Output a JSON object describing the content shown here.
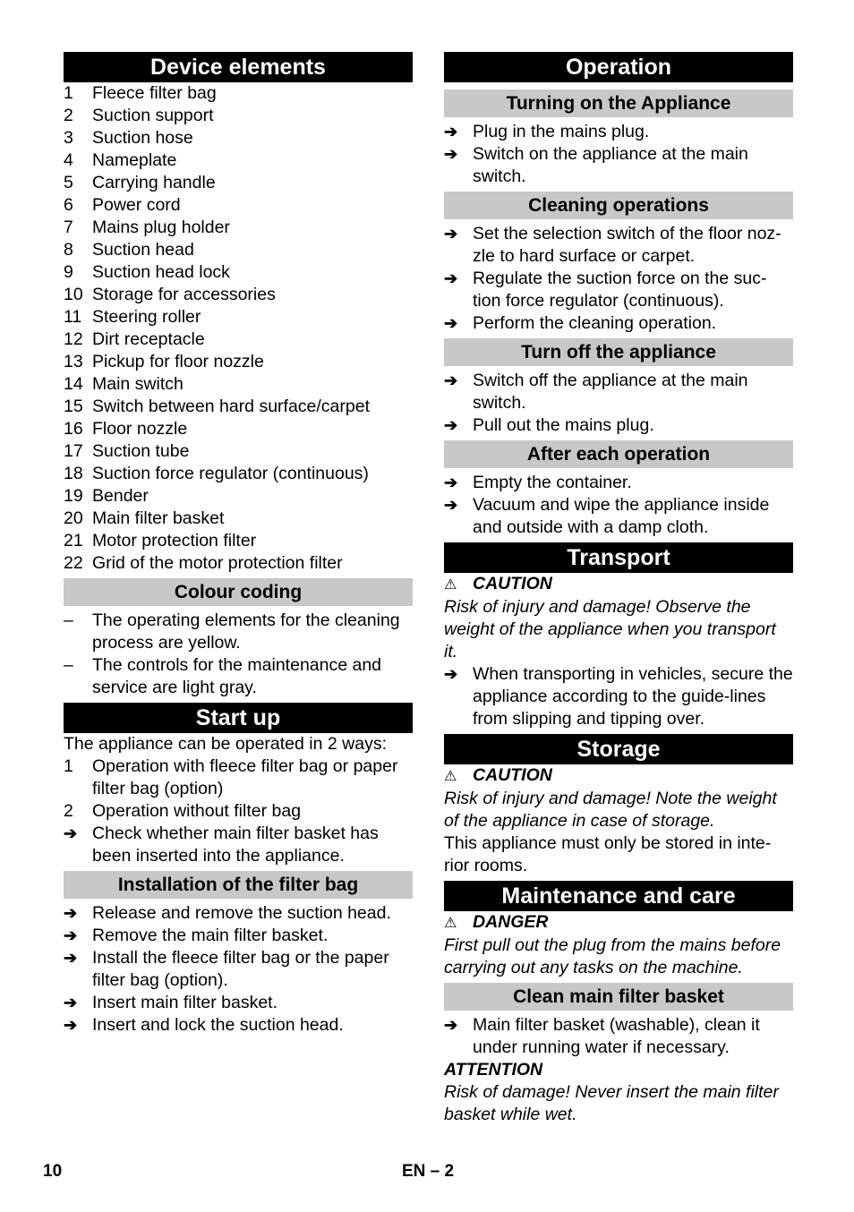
{
  "left": {
    "device_elements": {
      "title": "Device elements",
      "items": [
        {
          "num": "1",
          "text": "Fleece filter bag"
        },
        {
          "num": "2",
          "text": "Suction support"
        },
        {
          "num": "3",
          "text": "Suction hose"
        },
        {
          "num": "4",
          "text": "Nameplate"
        },
        {
          "num": "5",
          "text": "Carrying handle"
        },
        {
          "num": "6",
          "text": "Power cord"
        },
        {
          "num": "7",
          "text": "Mains plug holder"
        },
        {
          "num": "8",
          "text": "Suction head"
        },
        {
          "num": "9",
          "text": "Suction head lock"
        },
        {
          "num": "10",
          "text": "Storage for accessories"
        },
        {
          "num": "11",
          "text": "Steering roller"
        },
        {
          "num": "12",
          "text": "Dirt receptacle"
        },
        {
          "num": "13",
          "text": "Pickup for floor nozzle"
        },
        {
          "num": "14",
          "text": "Main switch"
        },
        {
          "num": "15",
          "text": "Switch between hard surface/carpet"
        },
        {
          "num": "16",
          "text": "Floor nozzle"
        },
        {
          "num": "17",
          "text": "Suction tube"
        },
        {
          "num": "18",
          "text": "Suction force regulator (continuous)"
        },
        {
          "num": "19",
          "text": "Bender"
        },
        {
          "num": "20",
          "text": "Main filter basket"
        },
        {
          "num": "21",
          "text": "Motor protection filter"
        },
        {
          "num": "22",
          "text": "Grid of the motor protection filter"
        }
      ]
    },
    "colour_coding": {
      "title": "Colour coding",
      "bullet": "–",
      "items": [
        "The operating elements for the cleaning process are yellow.",
        "The controls for the maintenance and service are light gray."
      ]
    },
    "start_up": {
      "title": "Start up",
      "intro": "The appliance can be operated in 2 ways:",
      "ways": [
        {
          "num": "1",
          "text": "Operation with fleece filter bag or paper filter bag (option)"
        },
        {
          "num": "2",
          "text": "Operation without filter bag"
        }
      ],
      "check": "Check whether main filter basket has been inserted into the appliance."
    },
    "filter_bag": {
      "title": "Installation of the filter bag",
      "steps": [
        "Release and remove the suction head.",
        "Remove the main filter basket.",
        "Install the fleece filter bag or the paper filter bag (option).",
        "Insert main filter basket.",
        "Insert and lock the suction head."
      ]
    }
  },
  "right": {
    "operation": {
      "title": "Operation",
      "turning_on": {
        "title": "Turning on the Appliance",
        "steps": [
          "Plug in the mains plug.",
          "Switch on the appliance at the main switch."
        ]
      },
      "cleaning": {
        "title": "Cleaning operations",
        "steps": [
          "Set the selection switch of the floor noz-zle to hard surface or carpet.",
          "Regulate the suction force on the suc-tion force regulator (continuous).",
          "Perform the cleaning operation."
        ]
      },
      "turn_off": {
        "title": "Turn off the appliance",
        "steps": [
          "Switch off the appliance at the main switch.",
          "Pull out the mains plug."
        ]
      },
      "after_each": {
        "title": "After each operation",
        "steps": [
          "Empty the container.",
          "Vacuum and wipe the appliance inside and outside with a damp cloth."
        ]
      }
    },
    "transport": {
      "title": "Transport",
      "warning_label": "CAUTION",
      "warning_text": "Risk of injury and damage! Observe the weight of the appliance when you transport it.",
      "step": "When transporting in vehicles, secure the appliance according to the guide-lines from slipping and tipping over."
    },
    "storage": {
      "title": "Storage",
      "warning_label": "CAUTION",
      "warning_text": "Risk of injury and damage! Note the weight of the appliance in case of storage.",
      "note": "This appliance must only be stored in inte-rior rooms."
    },
    "maintenance": {
      "title": "Maintenance and care",
      "warning_label": "DANGER",
      "warning_text": "First pull out the plug from the mains before carrying out any tasks on the machine.",
      "clean_basket": {
        "title": "Clean main filter basket",
        "step": "Main filter basket (washable), clean it under running water if necessary.",
        "attention_label": "ATTENTION",
        "attention_text": "Risk of damage! Never insert the main filter basket while wet."
      }
    }
  },
  "icons": {
    "arrow": "➔",
    "warning": "⚠"
  },
  "footer": {
    "page_number": "10",
    "lang_page": "EN – 2"
  }
}
